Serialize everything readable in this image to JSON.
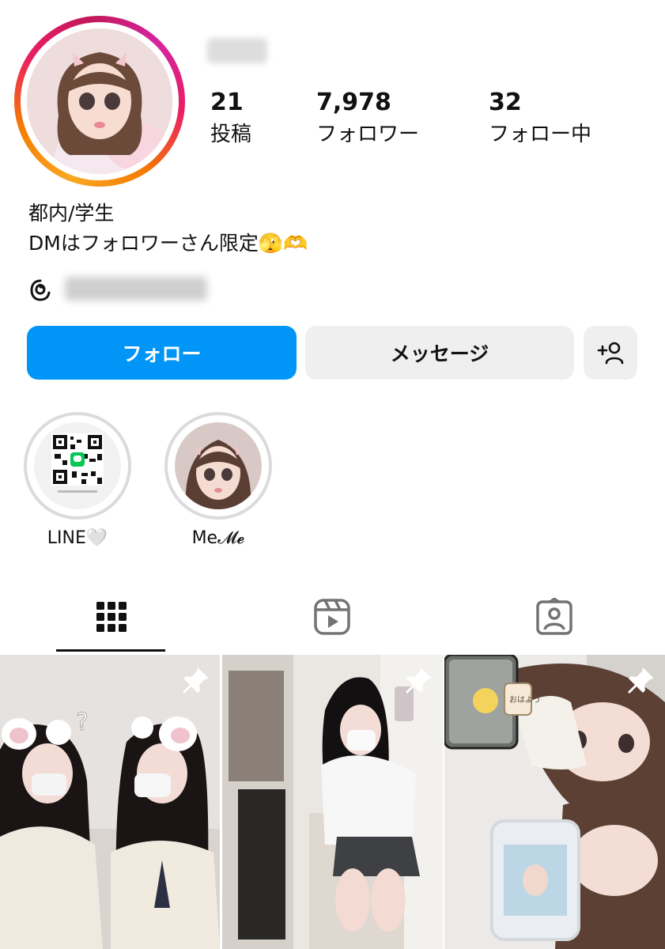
{
  "profile": {
    "stats": {
      "posts": {
        "count": "21",
        "label": "投稿"
      },
      "followers": {
        "count": "7,978",
        "label": "フォロワー"
      },
      "following": {
        "count": "32",
        "label": "フォロー中"
      }
    },
    "bio_line1": "都内/学生",
    "bio_line2": "DMはフォロワーさん限定🫣🫶"
  },
  "actions": {
    "follow_label": "フォロー",
    "message_label": "メッセージ",
    "suggest_icon": "add-person-icon"
  },
  "highlights": [
    {
      "label": "LINE🤍"
    },
    {
      "label": "Me𝓜𝓮"
    }
  ],
  "tabs": [
    {
      "icon": "grid-icon",
      "active": true
    },
    {
      "icon": "reels-icon",
      "active": false
    },
    {
      "icon": "tagged-icon",
      "active": false
    }
  ],
  "posts": [
    {
      "pinned": true,
      "caption_symbol": "?"
    },
    {
      "pinned": true
    },
    {
      "pinned": true,
      "sticker_text": "おはよう"
    }
  ],
  "colors": {
    "follow_button": "#0095f6",
    "secondary_button": "#efefef",
    "story_ring": [
      "#f9a825",
      "#e91e63",
      "#d6249f"
    ]
  }
}
